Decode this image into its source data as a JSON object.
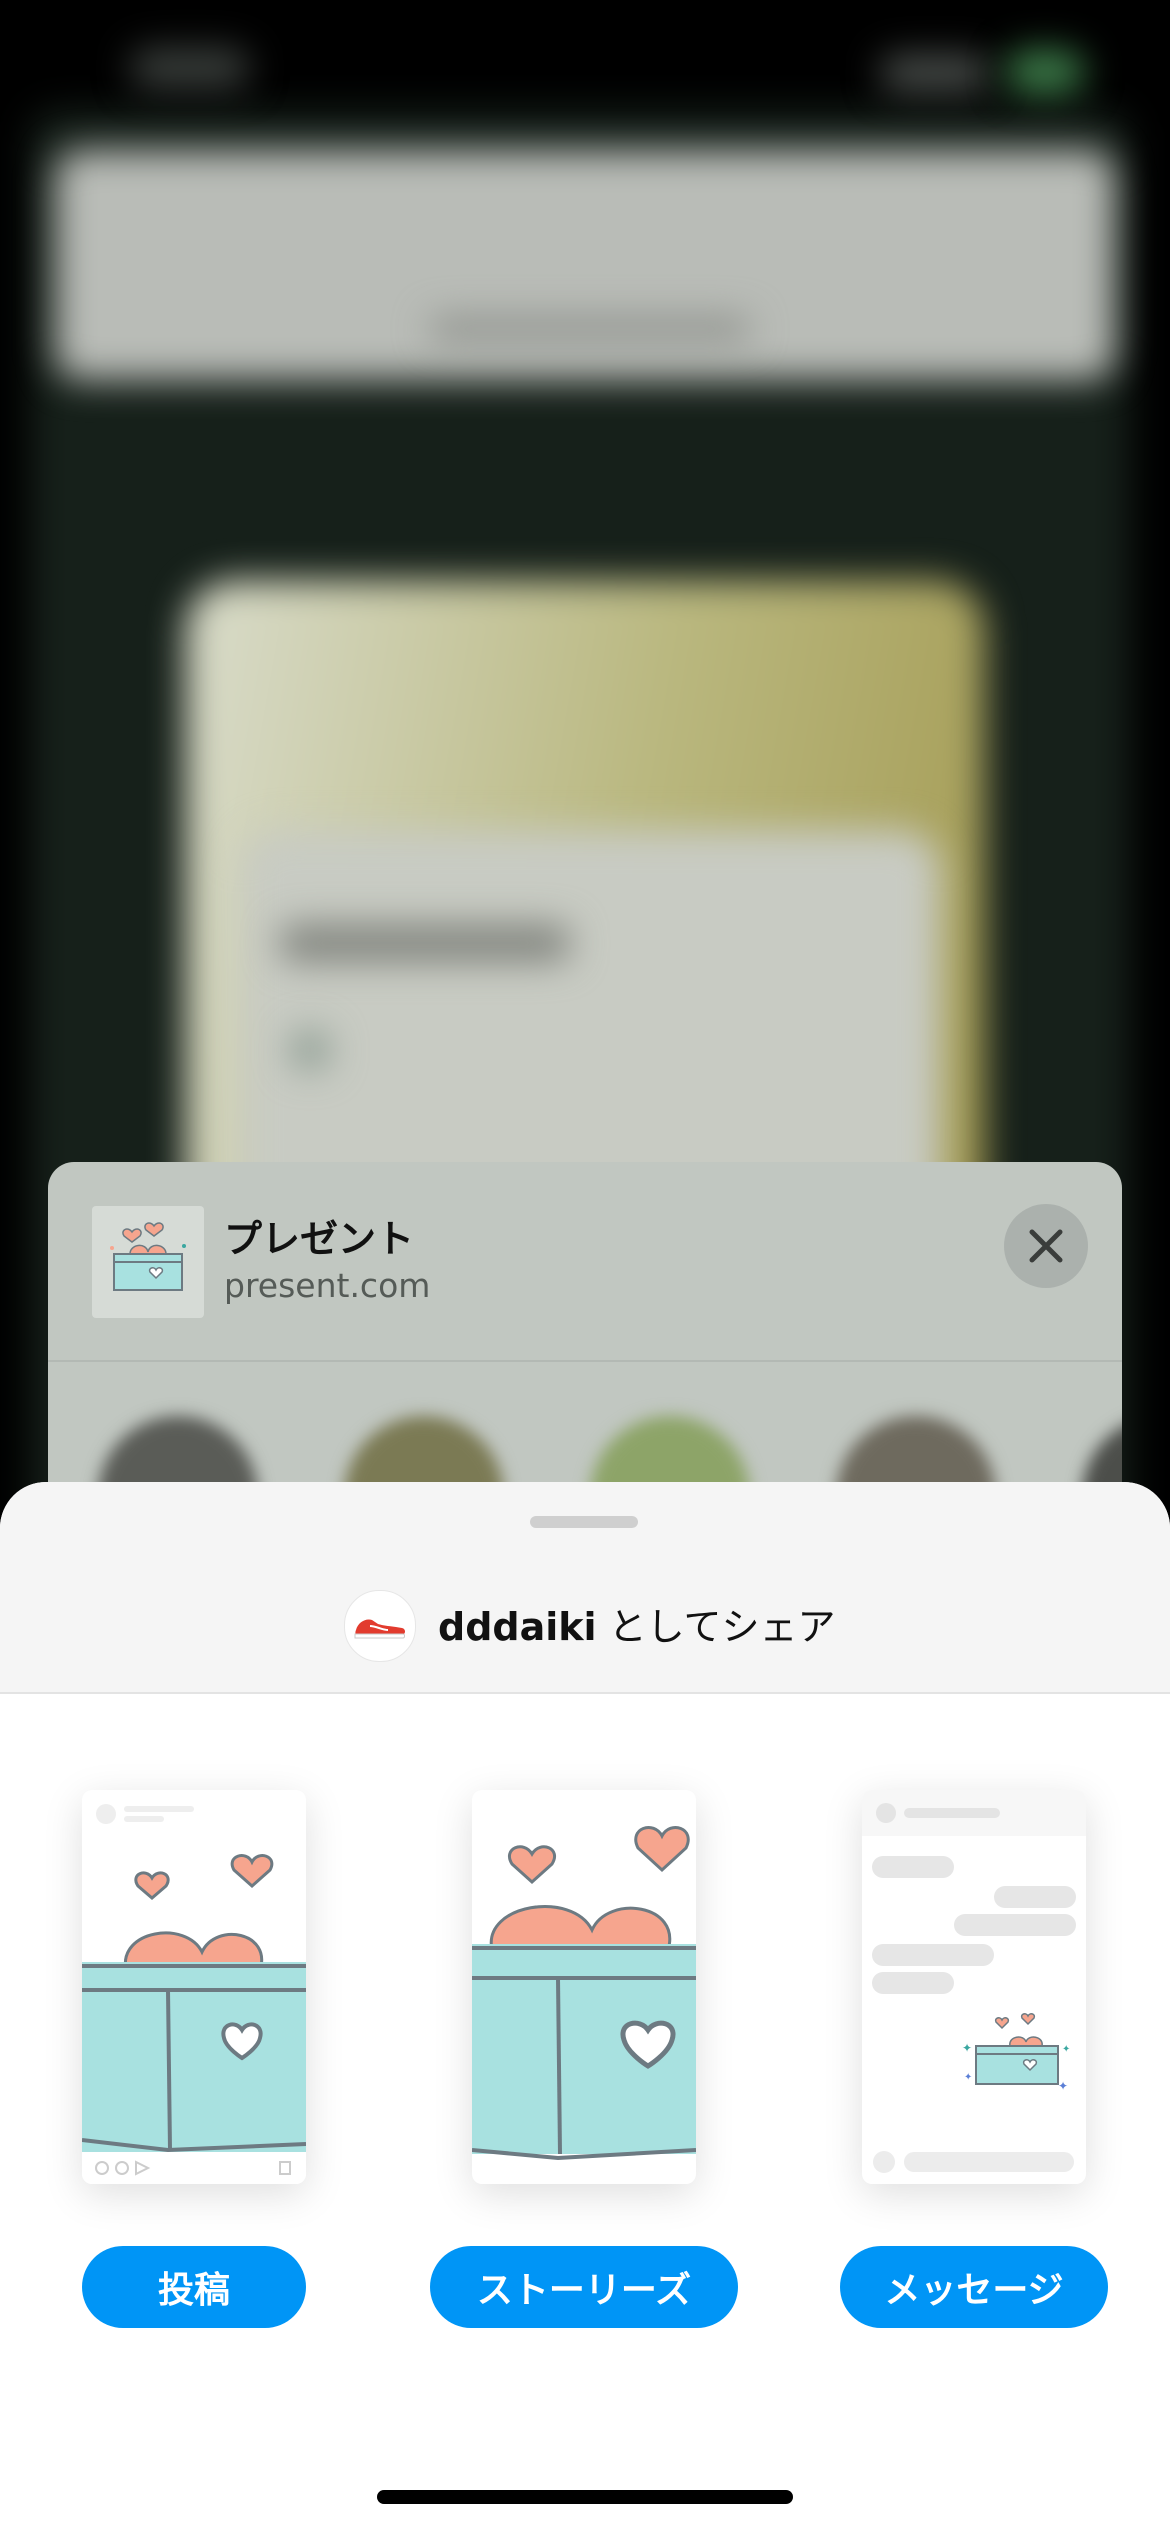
{
  "preview": {
    "title": "プレゼント",
    "url": "present.com",
    "close_icon": "close-icon"
  },
  "share_sheet": {
    "account_name": "dddaiki",
    "share_as_suffix": "としてシェア",
    "options": [
      {
        "label": "投稿",
        "icon": "feed-post-preview"
      },
      {
        "label": "ストーリーズ",
        "icon": "story-preview"
      },
      {
        "label": "メッセージ",
        "icon": "message-preview"
      }
    ]
  },
  "colors": {
    "accent_blue": "#0095f6",
    "heart_fill": "#f6a58e",
    "box_fill": "#a8e1e0",
    "box_stroke": "#6d7a82"
  }
}
